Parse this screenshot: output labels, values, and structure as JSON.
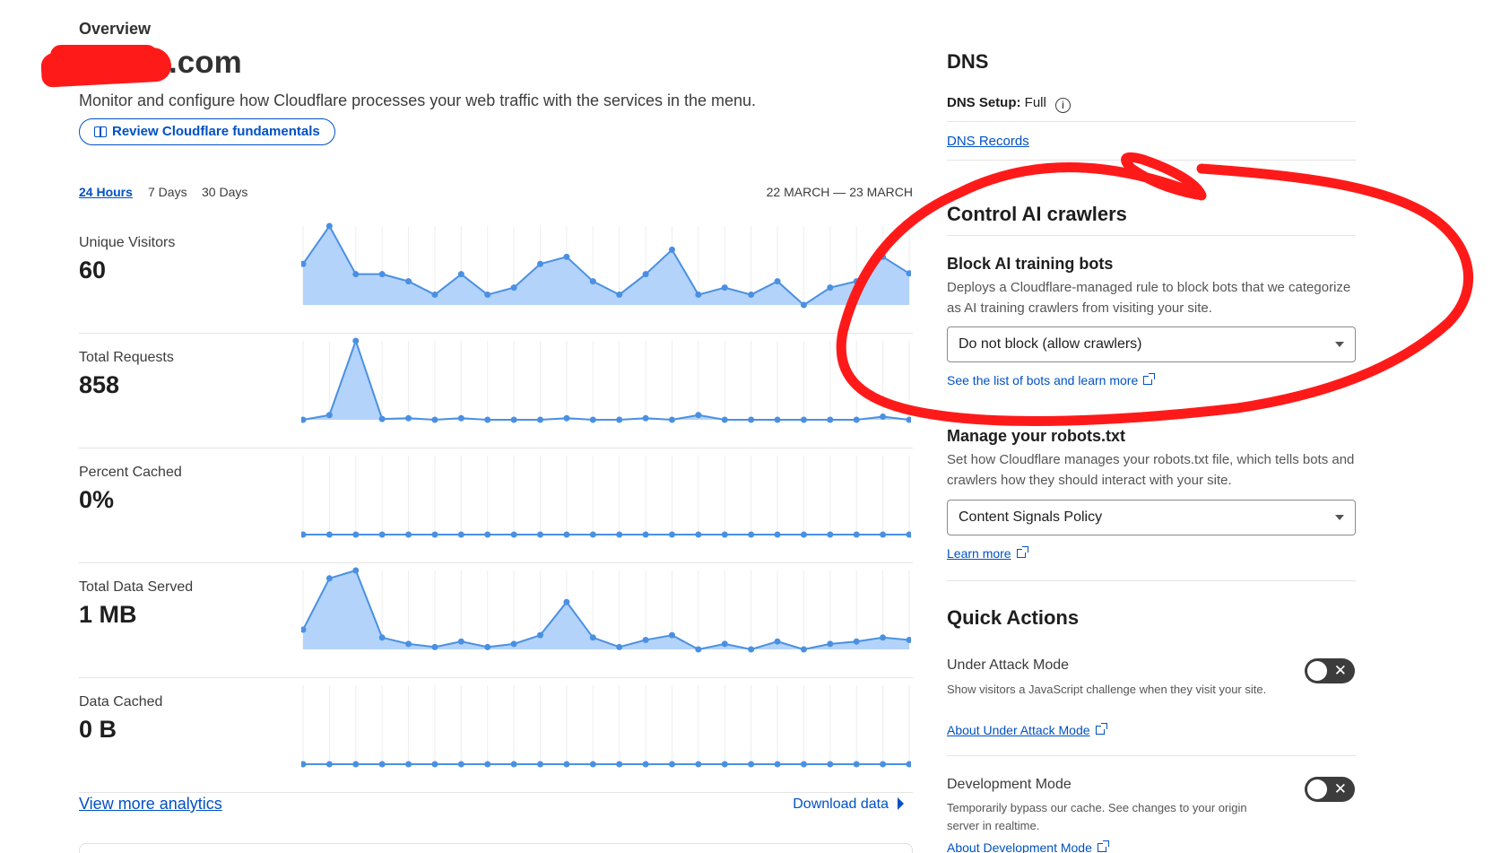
{
  "header": {
    "overview": "Overview",
    "domain_suffix": ".com",
    "subtitle": "Monitor and configure how Cloudflare processes your web traffic with the services in the menu.",
    "review_button": "Review Cloudflare fundamentals"
  },
  "tabs": [
    {
      "label": "24 Hours",
      "active": true
    },
    {
      "label": "7 Days",
      "active": false
    },
    {
      "label": "30 Days",
      "active": false
    }
  ],
  "date_range": "22 MARCH — 23 MARCH",
  "metrics": [
    {
      "label": "Unique Visitors",
      "value": "60"
    },
    {
      "label": "Total Requests",
      "value": "858"
    },
    {
      "label": "Percent Cached",
      "value": "0%"
    },
    {
      "label": "Total Data Served",
      "value": "1 MB"
    },
    {
      "label": "Data Cached",
      "value": "0 B"
    }
  ],
  "chart_data": [
    {
      "type": "area",
      "name": "Unique Visitors",
      "series": [
        {
          "values": [
            0.52,
            1.0,
            0.39,
            0.39,
            0.3,
            0.13,
            0.39,
            0.13,
            0.22,
            0.52,
            0.61,
            0.3,
            0.13,
            0.39,
            0.7,
            0.13,
            0.22,
            0.13,
            0.3,
            0.0,
            0.22,
            0.3,
            0.61,
            0.4
          ]
        }
      ]
    },
    {
      "type": "area",
      "name": "Total Requests",
      "series": [
        {
          "values": [
            0.0,
            0.06,
            1.0,
            0.01,
            0.02,
            0.0,
            0.02,
            0.0,
            0.0,
            0.0,
            0.02,
            0.0,
            0.0,
            0.02,
            0.0,
            0.06,
            0.0,
            0.0,
            0.0,
            0.0,
            0.0,
            0.0,
            0.04,
            0.0
          ]
        }
      ]
    },
    {
      "type": "area",
      "name": "Percent Cached",
      "series": [
        {
          "values": [
            0,
            0,
            0,
            0,
            0,
            0,
            0,
            0,
            0,
            0,
            0,
            0,
            0,
            0,
            0,
            0,
            0,
            0,
            0,
            0,
            0,
            0,
            0,
            0
          ]
        }
      ]
    },
    {
      "type": "area",
      "name": "Total Data Served",
      "series": [
        {
          "values": [
            0.25,
            0.9,
            1.0,
            0.15,
            0.07,
            0.03,
            0.1,
            0.03,
            0.07,
            0.18,
            0.6,
            0.15,
            0.03,
            0.12,
            0.18,
            0.0,
            0.07,
            0.0,
            0.1,
            0.0,
            0.07,
            0.1,
            0.15,
            0.12
          ]
        }
      ]
    },
    {
      "type": "area",
      "name": "Data Cached",
      "series": [
        {
          "values": [
            0,
            0,
            0,
            0,
            0,
            0,
            0,
            0,
            0,
            0,
            0,
            0,
            0,
            0,
            0,
            0,
            0,
            0,
            0,
            0,
            0,
            0,
            0,
            0
          ]
        }
      ]
    }
  ],
  "footer": {
    "view_more": "View more analytics",
    "download": "Download data"
  },
  "dns": {
    "title": "DNS",
    "setup_label": "DNS Setup:",
    "setup_value": "Full",
    "info": "i",
    "records_link": "DNS Records"
  },
  "ai_crawlers": {
    "title": "Control AI crawlers",
    "block_title": "Block AI training bots",
    "block_desc": "Deploys a Cloudflare-managed rule to block bots that we categorize as AI training crawlers from visiting your site.",
    "block_select": "Do not block (allow crawlers)",
    "bots_link": "See the list of bots and learn more",
    "robots_title": "Manage your robots.txt",
    "robots_desc": "Set how Cloudflare manages your robots.txt file, which tells bots and crawlers how they should interact with your site.",
    "robots_select": "Content Signals Policy",
    "learn_more": "Learn more"
  },
  "quick_actions": {
    "title": "Quick Actions",
    "items": [
      {
        "title": "Under Attack Mode",
        "desc": "Show visitors a JavaScript challenge when they visit your site.",
        "link": "About Under Attack Mode",
        "enabled": false
      },
      {
        "title": "Development Mode",
        "desc": "Temporarily bypass our cache. See changes to your origin server in realtime.",
        "link": "About Development Mode",
        "enabled": false
      }
    ]
  },
  "colors": {
    "accent": "#0051c3",
    "chart_line": "#4a90e2",
    "chart_fill": "#b3d3fb",
    "annotation": "#ff1a1a",
    "toggle_off": "#3c3c3c"
  }
}
